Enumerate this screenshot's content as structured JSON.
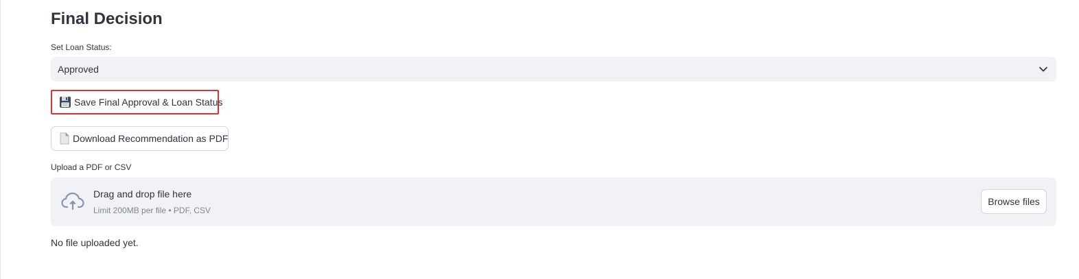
{
  "section": {
    "title": "Final Decision"
  },
  "loan_status": {
    "label": "Set Loan Status:",
    "selected": "Approved",
    "chevron_icon": "chevron-down-icon"
  },
  "buttons": {
    "save_label": "Save Final Approval & Loan Status",
    "save_icon": "floppy-disk-icon",
    "download_label": "Download Recommendation as PDF",
    "download_icon": "document-icon"
  },
  "uploader": {
    "label": "Upload a PDF or CSV",
    "title": "Drag and drop file here",
    "hint": "Limit 200MB per file • PDF, CSV",
    "browse_label": "Browse files",
    "icon": "cloud-upload-icon"
  },
  "status": {
    "text": "No file uploaded yet."
  },
  "colors": {
    "highlight_border": "#e03131",
    "input_bg": "#f0f2f6",
    "text": "#31333f",
    "muted": "#808495"
  }
}
